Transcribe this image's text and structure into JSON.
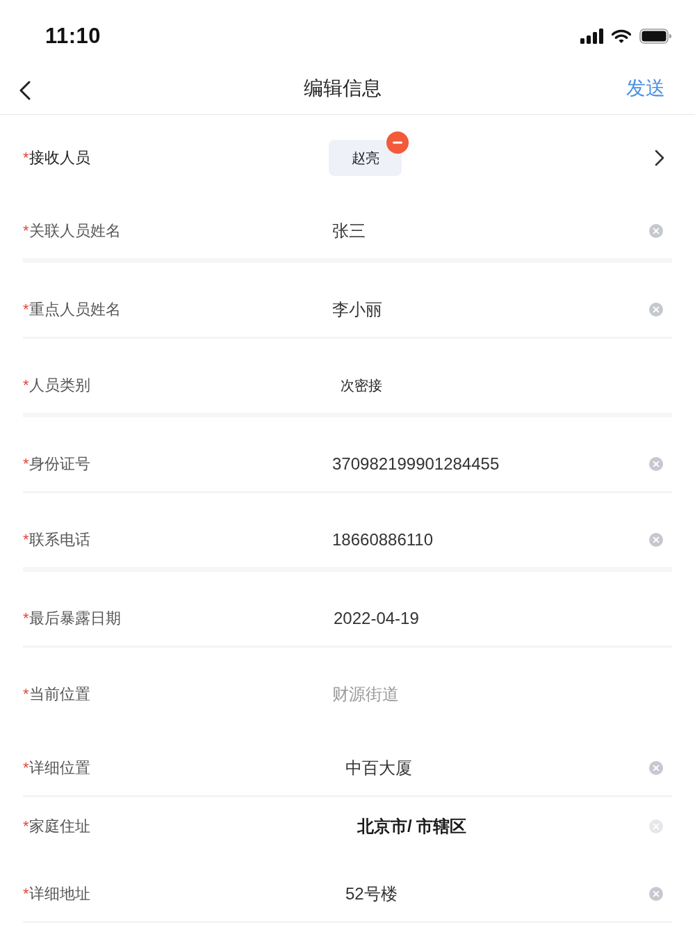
{
  "status_bar": {
    "time": "11:10"
  },
  "nav_bar": {
    "title": "编辑信息",
    "action": "发送"
  },
  "form": {
    "fields": [
      {
        "kind": "recipients",
        "required_mark": "*",
        "label": "接收人员",
        "chips": [
          {
            "name": "赵亮",
            "removable": true
          }
        ]
      },
      {
        "kind": "input",
        "required_mark": "*",
        "label": "关联人员姓名",
        "value": "张三",
        "clear": {
          "disabled": false
        }
      },
      {
        "kind": "input",
        "required_mark": "*",
        "label": "重点人员姓名",
        "value": "李小丽",
        "clear": {
          "disabled": false
        }
      },
      {
        "kind": "picker",
        "required_mark": "*",
        "label": "人员类别",
        "value": "次密接"
      },
      {
        "kind": "input",
        "required_mark": "*",
        "label": "身份证号",
        "value": "370982199901284455",
        "clear": {
          "disabled": false
        }
      },
      {
        "kind": "input",
        "required_mark": "*",
        "label": "联系电话",
        "value": "18660886110",
        "clear": {
          "disabled": false
        }
      },
      {
        "kind": "date",
        "required_mark": "*",
        "label": "最后暴露日期",
        "value": "2022-04-19"
      },
      {
        "kind": "location",
        "required_mark": "*",
        "label": "当前位置",
        "value": "财源街道"
      },
      {
        "kind": "textarea",
        "required_mark": "*",
        "label": "详细位置",
        "value": "中百大厦",
        "clear": {
          "disabled": false
        }
      },
      {
        "kind": "region",
        "required_mark": "*",
        "label": "家庭住址",
        "value": "北京市/ 市辖区",
        "clear": {
          "disabled": true
        }
      },
      {
        "kind": "textarea",
        "required_mark": "*",
        "label": "详细地址",
        "value": "52号楼",
        "clear": {
          "disabled": false
        }
      }
    ]
  }
}
